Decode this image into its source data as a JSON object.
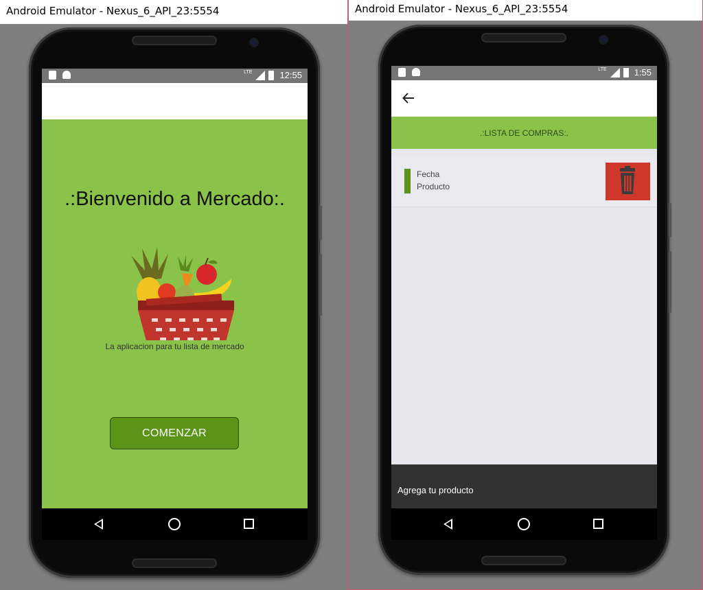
{
  "left_window": {
    "title": "Android Emulator - Nexus_6_API_23:5554",
    "status_time": "12:55",
    "status_network": "LTE",
    "welcome": {
      "title": ".:Bienvenido a Mercado:.",
      "subtitle": "La aplicacion para tu lista de mercado",
      "start_button": "COMENZAR",
      "image": "fruit-basket-icon"
    },
    "colors": {
      "background": "#8bc34a",
      "button": "#5c9418"
    }
  },
  "right_window": {
    "title": "Android Emulator - Nexus_6_API_23:5554",
    "status_time": "1:55",
    "status_network": "LTE",
    "header": ".:LISTA DE COMPRAS:.",
    "list_items": [
      {
        "fecha": "Fecha",
        "producto": "Producto",
        "delete_icon": "trash-icon"
      }
    ],
    "fab_label": "+",
    "snackbar": "Agrega tu producto",
    "colors": {
      "header": "#8bc34a",
      "accent": "#5c9418",
      "delete": "#d0372b",
      "list_bg": "#e8e7ee"
    }
  },
  "nav_icons": [
    "back-icon",
    "home-icon",
    "recents-icon"
  ]
}
